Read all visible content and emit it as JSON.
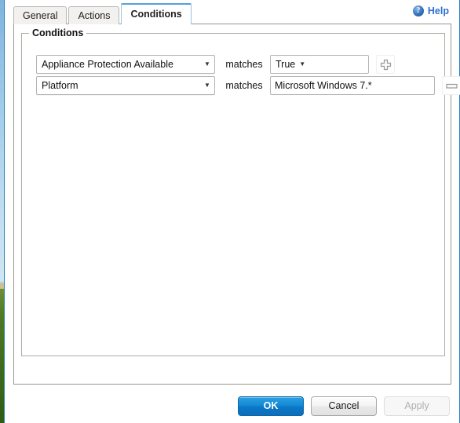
{
  "dialog": {
    "tabs": [
      {
        "label": "General",
        "active": false
      },
      {
        "label": "Actions",
        "active": false
      },
      {
        "label": "Conditions",
        "active": true
      }
    ],
    "help": {
      "label": "Help",
      "icon": "help-circle-icon",
      "glyph": "?",
      "color": "#2f6fd0"
    },
    "panel": {
      "fieldset_legend": "Conditions",
      "conditions": [
        {
          "field": "Appliance Protection Available",
          "operator": "matches",
          "value": "True",
          "value_control": "select",
          "row_action": "add",
          "row_action_glyph": "+"
        },
        {
          "field": "Platform",
          "operator": "matches",
          "value": "Microsoft Windows 7.*",
          "value_control": "text",
          "value_placeholder": "",
          "row_action": "remove",
          "row_action_glyph": "—"
        }
      ]
    },
    "footer": {
      "ok_label": "OK",
      "cancel_label": "Cancel",
      "apply_label": "Apply",
      "apply_disabled": true
    },
    "accent_color": "#1289d6",
    "border_color": "#2f7fc1"
  }
}
